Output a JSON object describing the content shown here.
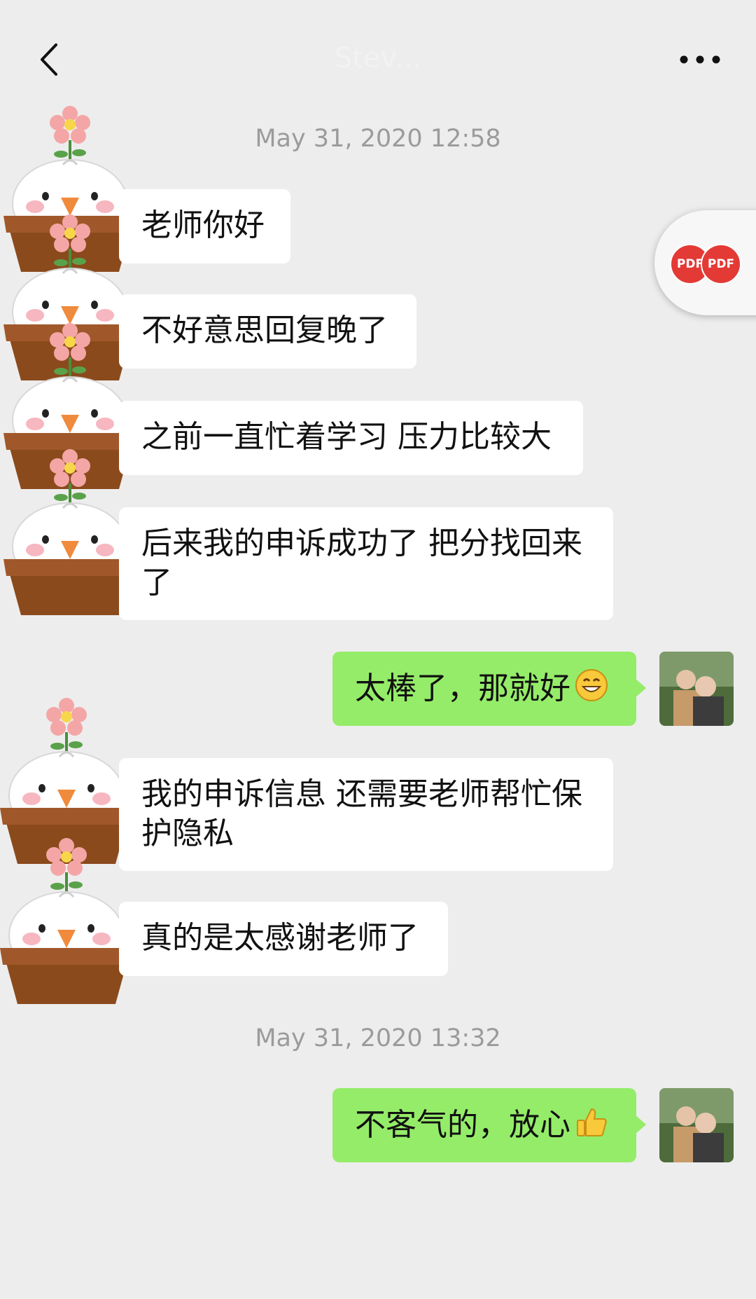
{
  "header": {
    "title": "Stev...",
    "back_icon": "chevron-left-icon",
    "more_icon": "more-dots-icon"
  },
  "floating": {
    "pdf_a": "PDF",
    "pdf_b": "PDF"
  },
  "timestamps": [
    "May 31, 2020 12:58",
    "May 31, 2020 13:32"
  ],
  "messages": [
    {
      "side": "left",
      "text": "老师你好"
    },
    {
      "side": "left",
      "text": "不好意思回复晚了"
    },
    {
      "side": "left",
      "text": "之前一直忙着学习 压力比较大"
    },
    {
      "side": "left",
      "text": "后来我的申诉成功了 把分找回来了"
    },
    {
      "side": "right",
      "text": "太棒了，那就好",
      "emoji": "grin-emoji-icon"
    },
    {
      "side": "left",
      "text": "我的申诉信息 还需要老师帮忙保护隐私"
    },
    {
      "side": "left",
      "text": "真的是太感谢老师了"
    },
    {
      "side": "right",
      "text": "不客气的，放心",
      "emoji": "thumbs-up-emoji-icon"
    }
  ],
  "colors": {
    "background": "#ededed",
    "sent_bubble": "#95ec69",
    "received_bubble": "#ffffff",
    "timestamp": "#9b9b9b"
  }
}
